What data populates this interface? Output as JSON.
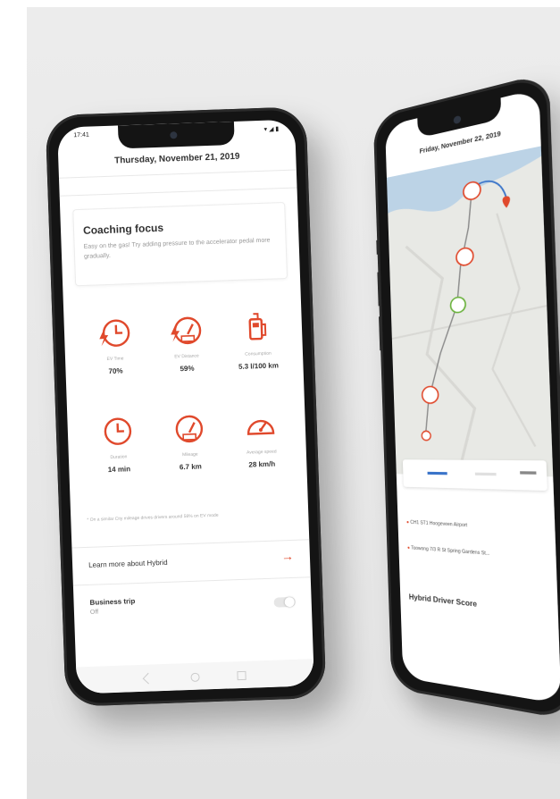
{
  "left_phone": {
    "status_time": "17:41",
    "date": "Thursday, November 21, 2019",
    "coaching": {
      "title": "Coaching focus",
      "body": "Easy on the gas! Try adding pressure to the accelerator pedal more gradually."
    },
    "metrics": [
      {
        "icon": "clock-bolt-icon",
        "label": "EV Time",
        "value": "70%"
      },
      {
        "icon": "gauge-bolt-icon",
        "label": "EV Distance",
        "value": "59%"
      },
      {
        "icon": "fuel-pump-icon",
        "label": "Consumption",
        "value": "5.3 l/100 km"
      },
      {
        "icon": "clock-icon",
        "label": "Duration",
        "value": "14 min"
      },
      {
        "icon": "gauge-icon",
        "label": "Mileage",
        "value": "6.7 km"
      },
      {
        "icon": "speedometer-icon",
        "label": "Average speed",
        "value": "28 km/h"
      }
    ],
    "footnote": "* On a similar City mileage drives drivers around 58% on EV mode",
    "learn_more": "Learn more about Hybrid",
    "business_trip": {
      "label": "Business trip",
      "value": "Off"
    }
  },
  "right_phone": {
    "date": "Friday, November 22, 2019",
    "route_start": "CH1 ST1 Hoogeveen Airport",
    "route_end": "Toowong 7/3 R St Spring Gardens St...",
    "hybrid_driver_score": "Hybrid Driver Score"
  },
  "colors": {
    "accent": "#e0492c",
    "green": "#6cb33f",
    "route_blue": "#3a74c9"
  }
}
